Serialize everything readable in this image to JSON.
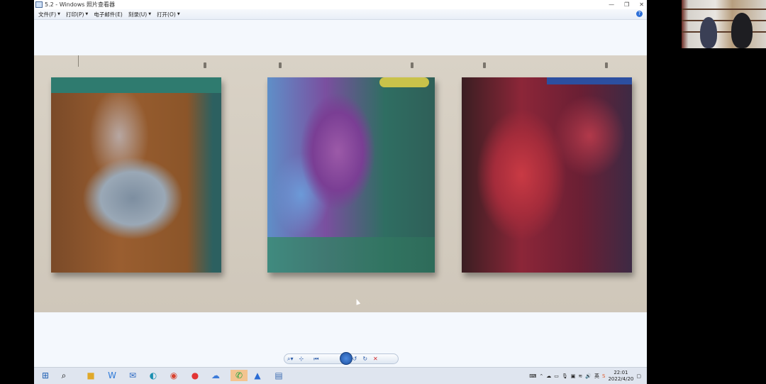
{
  "window": {
    "title": "5.2 - Windows 照片查看器",
    "buttons": {
      "minimize": "—",
      "maximize": "❐",
      "close": "✕"
    }
  },
  "menu": {
    "file": "文件(F)",
    "print": "打印(P)",
    "email": "电子邮件(E)",
    "burn": "刻录(U)",
    "open": "打开(O)",
    "help": "?"
  },
  "viewer": {
    "zoom": "⌕▾",
    "fit": "⊹",
    "prev": "⏮",
    "slideshow": "▣",
    "next": "⏭",
    "rotate_left": "↺",
    "rotate_right": "↻",
    "delete": "✕"
  },
  "taskbar": {
    "icons": [
      "windows-icon",
      "search-icon",
      "file-explorer-icon",
      "wps-writer-icon",
      "mail-icon",
      "edge-icon",
      "chrome-icon",
      "netease-music-icon",
      "baidu-netdisk-icon",
      "wechat-icon",
      "lanxin-icon",
      "photos-icon"
    ],
    "tray": {
      "time": "22:01",
      "date": "2022/4/20"
    }
  },
  "colors": {
    "accent": "#2d6fd8",
    "taskbar": "#dfe5ef",
    "active_app": "#f3c490"
  }
}
